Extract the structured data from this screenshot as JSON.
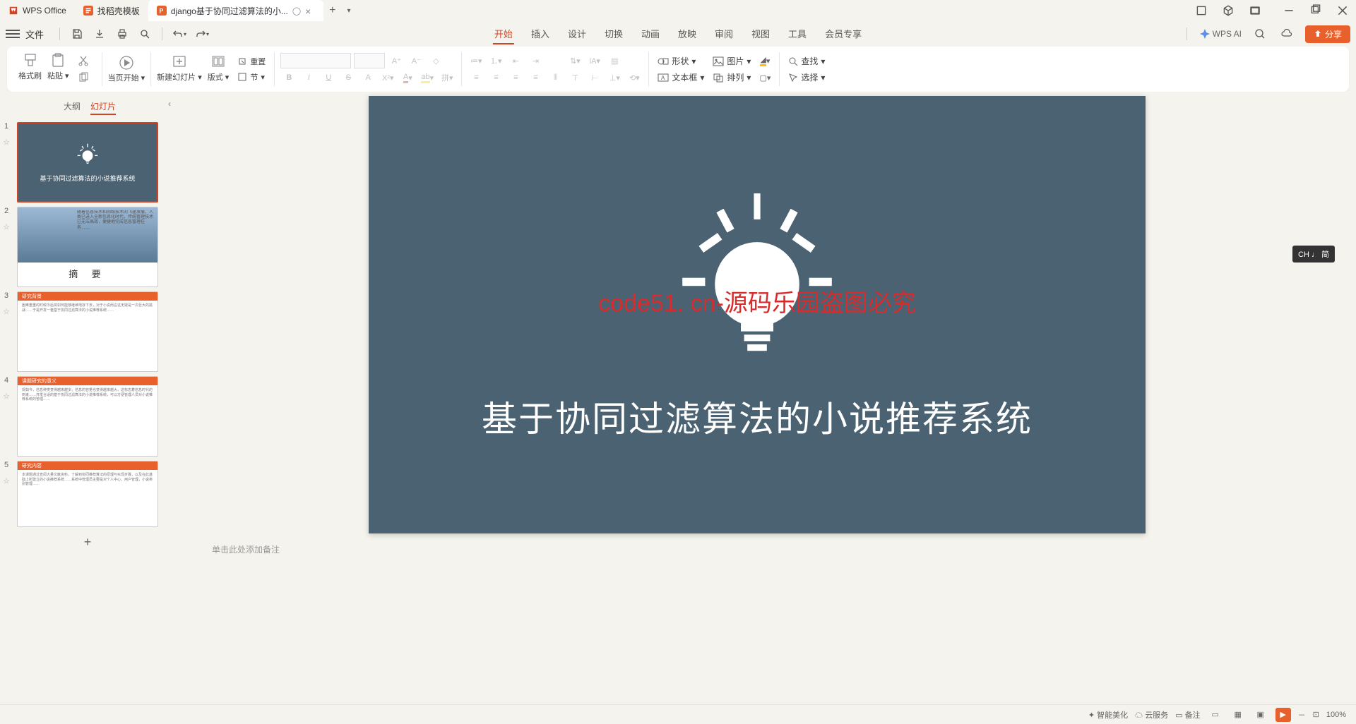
{
  "tabs": {
    "t0": "WPS Office",
    "t1": "找稻壳模板",
    "t2": "django基于协同过滤算法的小..."
  },
  "fileBar": {
    "label": "文件"
  },
  "menuTabs": [
    "开始",
    "插入",
    "设计",
    "切换",
    "动画",
    "放映",
    "审阅",
    "视图",
    "工具",
    "会员专享"
  ],
  "rightTools": {
    "ai": "WPS AI",
    "share": "分享"
  },
  "ribbon": {
    "formatBrush": "格式刷",
    "paste": "粘贴",
    "playFrom": "当页开始",
    "newSlide": "新建幻灯片",
    "layout": "版式",
    "section": "节",
    "reset": "重置",
    "shape": "形状",
    "textbox": "文本框",
    "image": "图片",
    "arrange": "排列",
    "find": "查找",
    "select": "选择"
  },
  "sidePanel": {
    "outline": "大纲",
    "slides": "幻灯片"
  },
  "thumbs": {
    "t1": "基于协同过滤算法的小说推荐系统",
    "t2a": "摘    要",
    "t3h": "研究背景",
    "t4h": "课题研究的意义",
    "t5h": "研究内容"
  },
  "slide": {
    "watermark": "code51. cn-源码乐园盗图必究",
    "title": "基于协同过滤算法的小说推荐系统"
  },
  "notes": {
    "placeholder": "单击此处添加备注"
  },
  "ime": "CH ♩ 简",
  "statusBar": {
    "beautify": "智能美化",
    "service": "云服务",
    "noteBtn": "备注",
    "zoom": "100%"
  }
}
